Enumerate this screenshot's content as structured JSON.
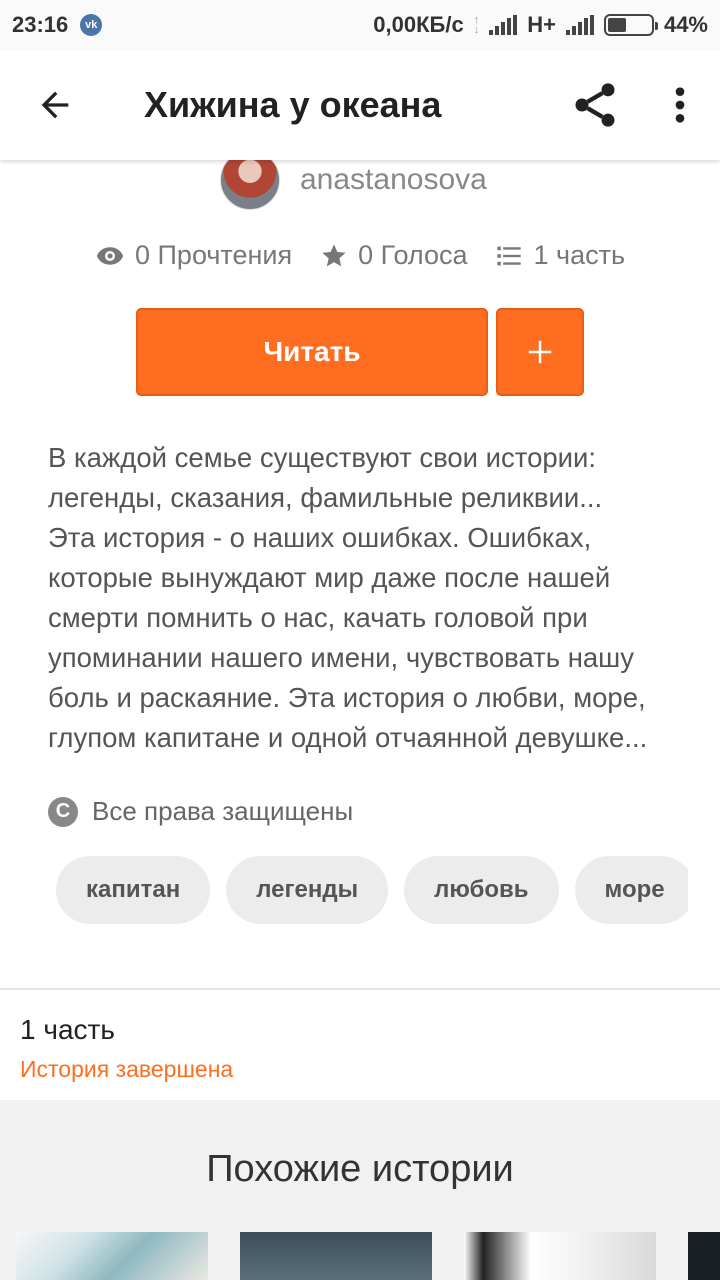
{
  "status_bar": {
    "time": "23:16",
    "notification_badge": "vk",
    "network_speed": "0,00КБ/с",
    "network_type": "H+",
    "battery": "44%",
    "battery_level": 0.44
  },
  "app_bar": {
    "title": "Хижина у океана",
    "icons": [
      "back-arrow-icon",
      "share-icon",
      "more-vertical-icon"
    ]
  },
  "author": {
    "name": "anastanosova"
  },
  "stats": {
    "reads": "0 Прочтения",
    "votes": "0 Голоса",
    "parts": "1 часть",
    "icons": [
      "eye-icon",
      "star-icon",
      "list-icon"
    ]
  },
  "actions": {
    "read_label": "Читать",
    "add_label": "+"
  },
  "description": "В каждой семье существуют свои истории:\nлегенды, сказания, фамильные реликвии...\nЭта история - о наших ошибках. Ошибках,\nкоторые вынуждают мир даже после нашей\nсмерти помнить о нас, качать головой при\nупоминании нашего имени, чувствовать нашу\nболь и раскаяние. Эта история о любви, море,\nглупом капитане и одной отчаянной девушке...",
  "copyright": {
    "symbol": "C",
    "label": "Все права защищены"
  },
  "tags": [
    "капитан",
    "легенды",
    "любовь",
    "море"
  ],
  "parts_section": {
    "title": "1 часть",
    "status": "История завершена"
  },
  "similar": {
    "title": "Похожие истории"
  },
  "colors": {
    "accent": "#ff6d20",
    "tag_bg": "#ececec",
    "section_bg": "#f1f1f1"
  }
}
